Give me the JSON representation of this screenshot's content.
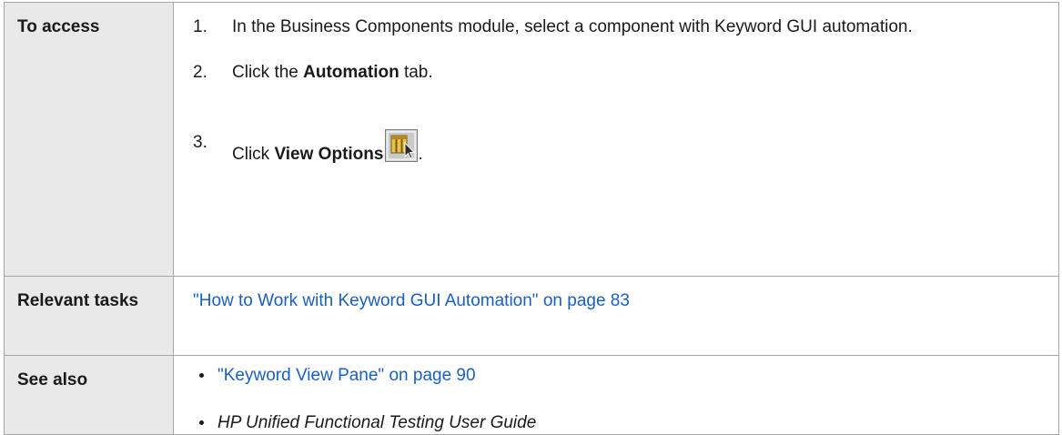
{
  "access": {
    "label": "To access",
    "steps": [
      {
        "num": "1.",
        "text": "In the Business Components module, select a component with Keyword GUI automation."
      },
      {
        "num": "2.",
        "pre": "Click the ",
        "bold": "Automation",
        "post": " tab."
      },
      {
        "num": "3.",
        "pre": "Click ",
        "bold": "View Options",
        "post": "."
      }
    ],
    "icon": "view-options-icon"
  },
  "relevant_tasks": {
    "label": "Relevant tasks",
    "link": "\"How to Work with Keyword GUI Automation\" on page 83"
  },
  "see_also": {
    "label": "See also",
    "items": [
      {
        "text": "\"Keyword View Pane\" on page 90"
      },
      {
        "text": "HP Unified Functional Testing User Guide"
      }
    ]
  },
  "colors": {
    "link": "#1a5fbf",
    "label_bg": "#e9e9e9",
    "border": "#a6a6a6"
  }
}
